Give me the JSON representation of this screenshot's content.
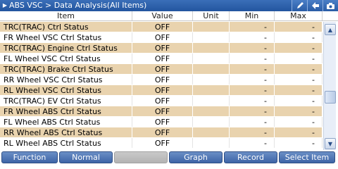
{
  "titlebar": {
    "breadcrumb": "ABS VSC > Data Analysis(All Items)",
    "buttons": [
      {
        "name": "pen-icon"
      },
      {
        "name": "back-arrow-icon"
      },
      {
        "name": "camera-icon"
      }
    ]
  },
  "header": {
    "item": "Item",
    "value": "Value",
    "unit": "Unit",
    "min": "Min",
    "max": "Max"
  },
  "rows": [
    {
      "item": "TRC(TRAC) Ctrl Status",
      "value": "OFF",
      "unit": "",
      "min": "-",
      "max": "-"
    },
    {
      "item": "FR Wheel VSC Ctrl Status",
      "value": "OFF",
      "unit": "",
      "min": "-",
      "max": "-"
    },
    {
      "item": "TRC(TRAC) Engine Ctrl Status",
      "value": "OFF",
      "unit": "",
      "min": "-",
      "max": "-"
    },
    {
      "item": "FL Wheel VSC Ctrl Status",
      "value": "OFF",
      "unit": "",
      "min": "-",
      "max": "-"
    },
    {
      "item": "TRC(TRAC) Brake Ctrl Status",
      "value": "OFF",
      "unit": "",
      "min": "-",
      "max": "-"
    },
    {
      "item": "RR Wheel VSC Ctrl Status",
      "value": "OFF",
      "unit": "",
      "min": "-",
      "max": "-"
    },
    {
      "item": "RL Wheel VSC Ctrl Status",
      "value": "OFF",
      "unit": "",
      "min": "-",
      "max": "-"
    },
    {
      "item": "TRC(TRAC) EV Ctrl Status",
      "value": "OFF",
      "unit": "",
      "min": "-",
      "max": "-"
    },
    {
      "item": "FR Wheel ABS Ctrl Status",
      "value": "OFF",
      "unit": "",
      "min": "-",
      "max": "-"
    },
    {
      "item": "FL Wheel ABS Ctrl Status",
      "value": "OFF",
      "unit": "",
      "min": "-",
      "max": "-"
    },
    {
      "item": "RR Wheel ABS Ctrl Status",
      "value": "OFF",
      "unit": "",
      "min": "-",
      "max": "-"
    },
    {
      "item": "RL Wheel ABS Ctrl Status",
      "value": "OFF",
      "unit": "",
      "min": "-",
      "max": "-"
    }
  ],
  "toolbar": {
    "function_label": "Function",
    "normal_label": "Normal",
    "blank_label": "",
    "graph_label": "Graph",
    "record_label": "Record",
    "select_item_label": "Select Item"
  },
  "colors": {
    "titlebar": "#23559f",
    "row_highlight": "#e9d3ae",
    "button": "#3d64a6"
  }
}
